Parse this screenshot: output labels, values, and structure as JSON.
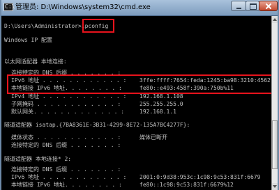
{
  "window": {
    "title": "管理员: D:\\Windows\\system32\\cmd.exe",
    "icon_label": "C:\\"
  },
  "console": {
    "prompt": "D:\\Users\\Administrator>",
    "command": "ipconfig",
    "ip_config_header": "Windows IP 配置",
    "adapter_local": "以太网适配器 本地连接:",
    "dns_suffix_label": "连接特定的 DNS 后缀 . . . . . . . :",
    "ipv6_label": "IPv6 地址 . . . . . . . . . . . . :",
    "ipv6_value": "3ffe:ffff:7654:feda:1245:ba98:3210:4562",
    "link_local_label": "本地链接 IPv6 地址. . . . . . . . :",
    "link_local_value": "fe80::e493:458f:390a:750b%11",
    "ipv4_label": "IPv4 地址 . . . . . . . . . . . . :",
    "ipv4_value": "192.168.1.108",
    "subnet_label": "子网掩码 . . . . . . . . . . . . :",
    "subnet_value": "255.255.255.0",
    "gateway_label": "默认网关. . . . . . . . . . . . . :",
    "gateway_value": "192.168.1.1",
    "adapter_isatap": "隧道适配器 isatap.{7BA8361E-3B31-4299-8E72-135A7BC4277F}:",
    "media_state_label": "媒体状态 . . . . . . . . . . . . :",
    "media_state_value": "媒体已断开",
    "dns_suffix_label_2": "连接特定的 DNS 后缀 . . . . . . . :",
    "adapter_local2": "隧道适配器 本地连接* 2:",
    "dns_suffix_label_3": "连接特定的 DNS 后缀 . . . . . . . :",
    "ipv6_label_2": "IPv6 地址 . . . . . . . . . . . . :",
    "ipv6_value_2": "2001:0:9d38:953c:1c98:9c53:831f:6679",
    "link_local_label_2": "本地链接 IPv6 地址. . . . . . . . :",
    "link_local_value_2": "fe80::1c98:9c53:831f:6679%12"
  },
  "colors": {
    "highlight": "#e8131c",
    "console_bg": "#000000",
    "console_text": "#c0c0c0"
  }
}
